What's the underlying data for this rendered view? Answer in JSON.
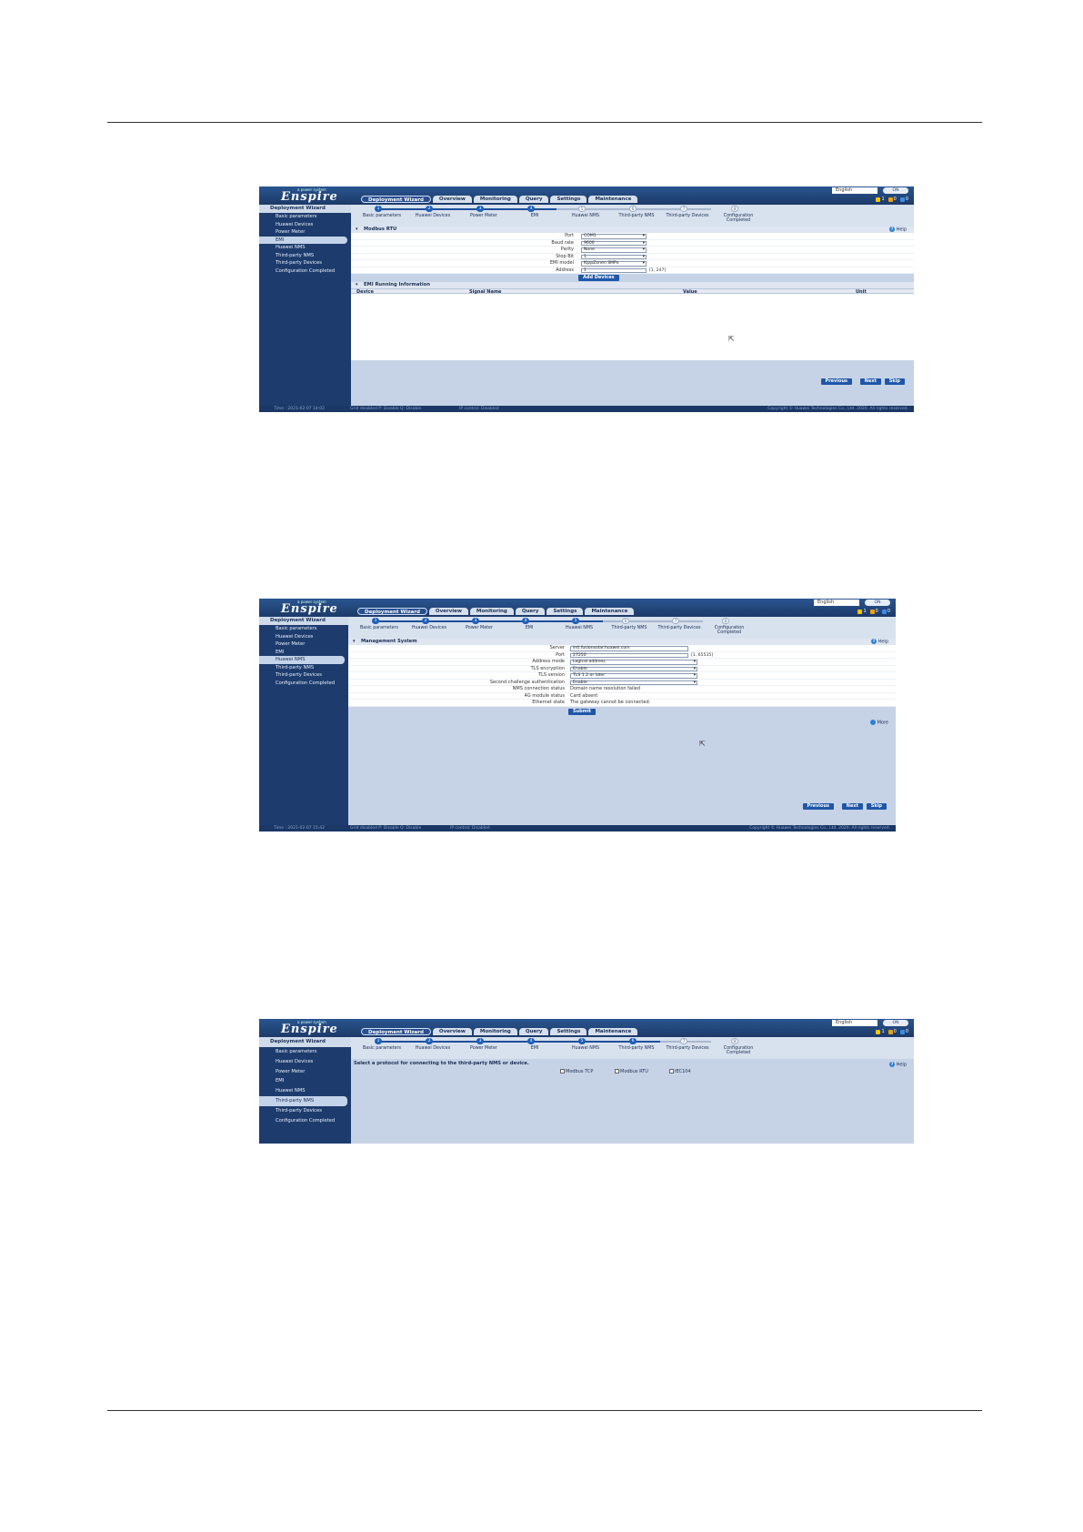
{
  "common": {
    "logo": "Enspire",
    "logo_sub": "a power system",
    "tabs": [
      "Deployment Wizard",
      "Overview",
      "Monitoring",
      "Query",
      "Settings",
      "Maintenance"
    ],
    "language": "English",
    "toggle": "ON",
    "alarms": [
      "1",
      "0",
      "0"
    ],
    "sidebar_title": "Deployment Wizard",
    "sidebar_items": [
      "Basic parameters",
      "Huawei Devices",
      "Power Meter",
      "EMI",
      "Huawei NMS",
      "Third-party NMS",
      "Third-party Devices",
      "Configuration Completed"
    ],
    "step_labels": [
      "Basic parameters",
      "Huawei Devices",
      "Power Meter",
      "EMI",
      "Huawei NMS",
      "Third-party NMS",
      "Third-party Devices",
      "Configuration Completed"
    ],
    "step_numbers": [
      "1",
      "2",
      "3",
      "4",
      "5",
      "6",
      "7",
      "8"
    ],
    "help": "Help",
    "previous": "Previous",
    "next": "Next",
    "skip": "Skip",
    "footer_copyright": "Copyright © Huawei Technologies Co., Ltd. 2020. All rights reserved."
  },
  "shot1": {
    "section1": "Modbus RTU",
    "fields": [
      {
        "label": "Port",
        "value": "COM1"
      },
      {
        "label": "Baud rate",
        "value": "9600"
      },
      {
        "label": "Parity",
        "value": "None"
      },
      {
        "label": "Stop Bit",
        "value": "1"
      },
      {
        "label": "EMI model",
        "value": "KippZonen SMPx"
      },
      {
        "label": "Address",
        "value": "1"
      }
    ],
    "address_hint": "[1, 247]",
    "add_button": "Add Devices",
    "section2": "EMI Running Information",
    "columns": [
      "Device",
      "Signal Name",
      "Value",
      "Unit"
    ],
    "footer_time": "Time : 2021-02-07 14:02",
    "footer_status": "Grid disabled  P: Disable  Q: Disable",
    "footer_control": "IP control: Disabled"
  },
  "shot2": {
    "section1": "Management System",
    "fields": [
      {
        "label": "Server",
        "value": "intl.fusionsolar.huawei.com",
        "type": "input"
      },
      {
        "label": "Port",
        "value": "27250",
        "type": "input"
      },
      {
        "label": "Address mode",
        "value": "Logical address",
        "type": "select"
      },
      {
        "label": "TLS encryption",
        "value": "Enable",
        "type": "select"
      },
      {
        "label": "TLS version",
        "value": "TLS 1.2 or later",
        "type": "select"
      },
      {
        "label": "Second challenge authentication",
        "value": "Enable",
        "type": "select"
      },
      {
        "label": "NMS connection status",
        "value": "Domain name resolution failed",
        "type": "text"
      },
      {
        "label": "4G module status",
        "value": "Card absent",
        "type": "text"
      },
      {
        "label": "Ethernet state",
        "value": "The gateway cannot be connected.",
        "type": "text"
      }
    ],
    "port_hint": "[1, 65535]",
    "submit": "Submit",
    "more": "More",
    "footer_time": "Time : 2021-02-07 15:42",
    "footer_status": "Grid disabled  P: Disable  Q: Disable",
    "footer_control": "IP control: Disabled"
  },
  "shot3": {
    "prompt": "Select a protocol for connecting to the third-party NMS or device.",
    "options": [
      "Modbus TCP",
      "Modbus RTU",
      "IEC104"
    ]
  }
}
